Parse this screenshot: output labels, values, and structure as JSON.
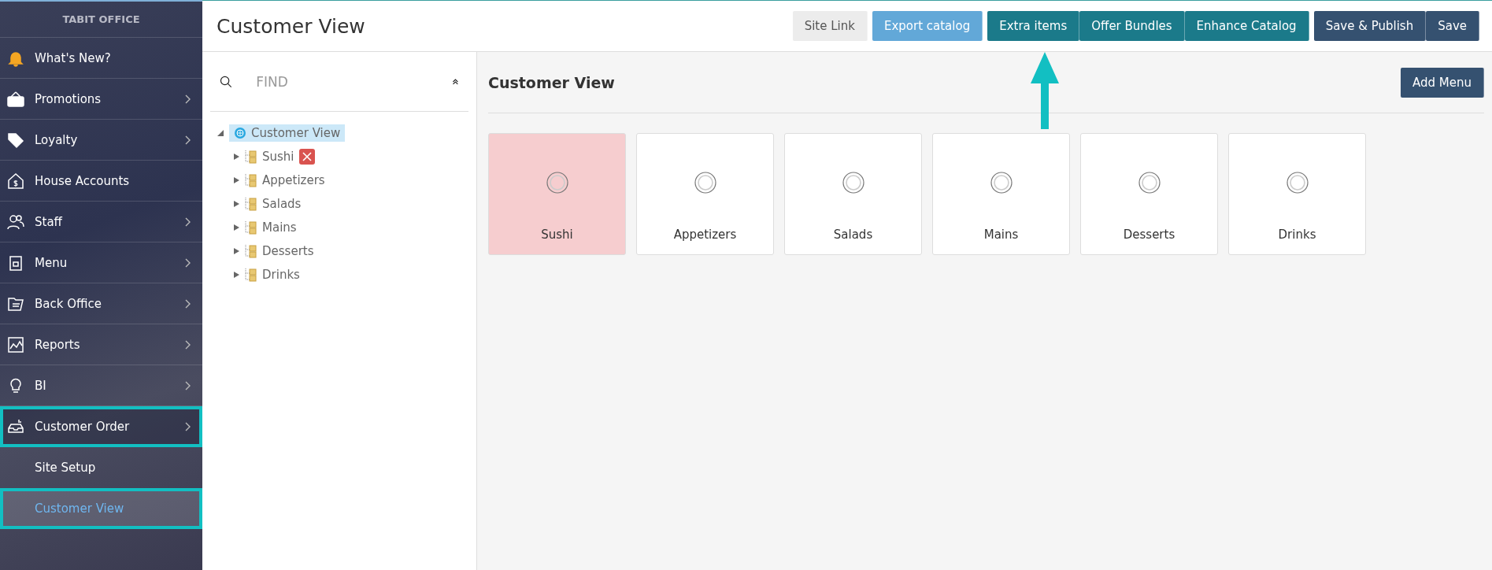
{
  "sidebar": {
    "brand": "TABIT OFFICE",
    "items": [
      {
        "label": "What's New?",
        "has_arrow": false,
        "highlighted": false,
        "expanded": false
      },
      {
        "label": "Promotions",
        "has_arrow": true,
        "highlighted": false,
        "expanded": false
      },
      {
        "label": "Loyalty",
        "has_arrow": true,
        "highlighted": false,
        "expanded": false
      },
      {
        "label": "House Accounts",
        "has_arrow": false,
        "highlighted": false,
        "expanded": false
      },
      {
        "label": "Staff",
        "has_arrow": true,
        "highlighted": false,
        "expanded": false
      },
      {
        "label": "Menu",
        "has_arrow": true,
        "highlighted": false,
        "expanded": false
      },
      {
        "label": "Back Office",
        "has_arrow": true,
        "highlighted": false,
        "expanded": false
      },
      {
        "label": "Reports",
        "has_arrow": true,
        "highlighted": false,
        "expanded": false
      },
      {
        "label": "BI",
        "has_arrow": true,
        "highlighted": false,
        "expanded": false
      },
      {
        "label": "Customer Order",
        "has_arrow": true,
        "highlighted": true,
        "expanded": true,
        "children": [
          {
            "label": "Site Setup",
            "selected": false,
            "highlighted": false
          },
          {
            "label": "Customer View",
            "selected": true,
            "highlighted": true
          }
        ]
      }
    ]
  },
  "header": {
    "title": "Customer View",
    "buttons": [
      {
        "label": "Site Link",
        "kind": "light"
      },
      {
        "label": "Export catalog",
        "kind": "blue"
      },
      {
        "label": "Extra items",
        "kind": "teal"
      },
      {
        "label": "Offer Bundles",
        "kind": "teal"
      },
      {
        "label": "Enhance Catalog",
        "kind": "teal"
      },
      {
        "label": "Save & Publish",
        "kind": "navy"
      },
      {
        "label": "Save",
        "kind": "navy"
      }
    ]
  },
  "tree": {
    "search": {
      "placeholder": "FIND"
    },
    "root": {
      "label": "Customer View",
      "selected": true,
      "expanded": true,
      "children": [
        {
          "label": "Sushi",
          "error": true,
          "expanded": false
        },
        {
          "label": "Appetizers",
          "error": false,
          "expanded": false
        },
        {
          "label": "Salads",
          "error": false,
          "expanded": false
        },
        {
          "label": "Mains",
          "error": false,
          "expanded": false
        },
        {
          "label": "Desserts",
          "error": false,
          "expanded": false
        },
        {
          "label": "Drinks",
          "error": false,
          "expanded": false
        }
      ]
    }
  },
  "content": {
    "title": "Customer View",
    "add_button": "Add Menu",
    "cards": [
      {
        "label": "Sushi",
        "error": true
      },
      {
        "label": "Appetizers",
        "error": false
      },
      {
        "label": "Salads",
        "error": false
      },
      {
        "label": "Mains",
        "error": false
      },
      {
        "label": "Desserts",
        "error": false
      },
      {
        "label": "Drinks",
        "error": false
      }
    ]
  }
}
